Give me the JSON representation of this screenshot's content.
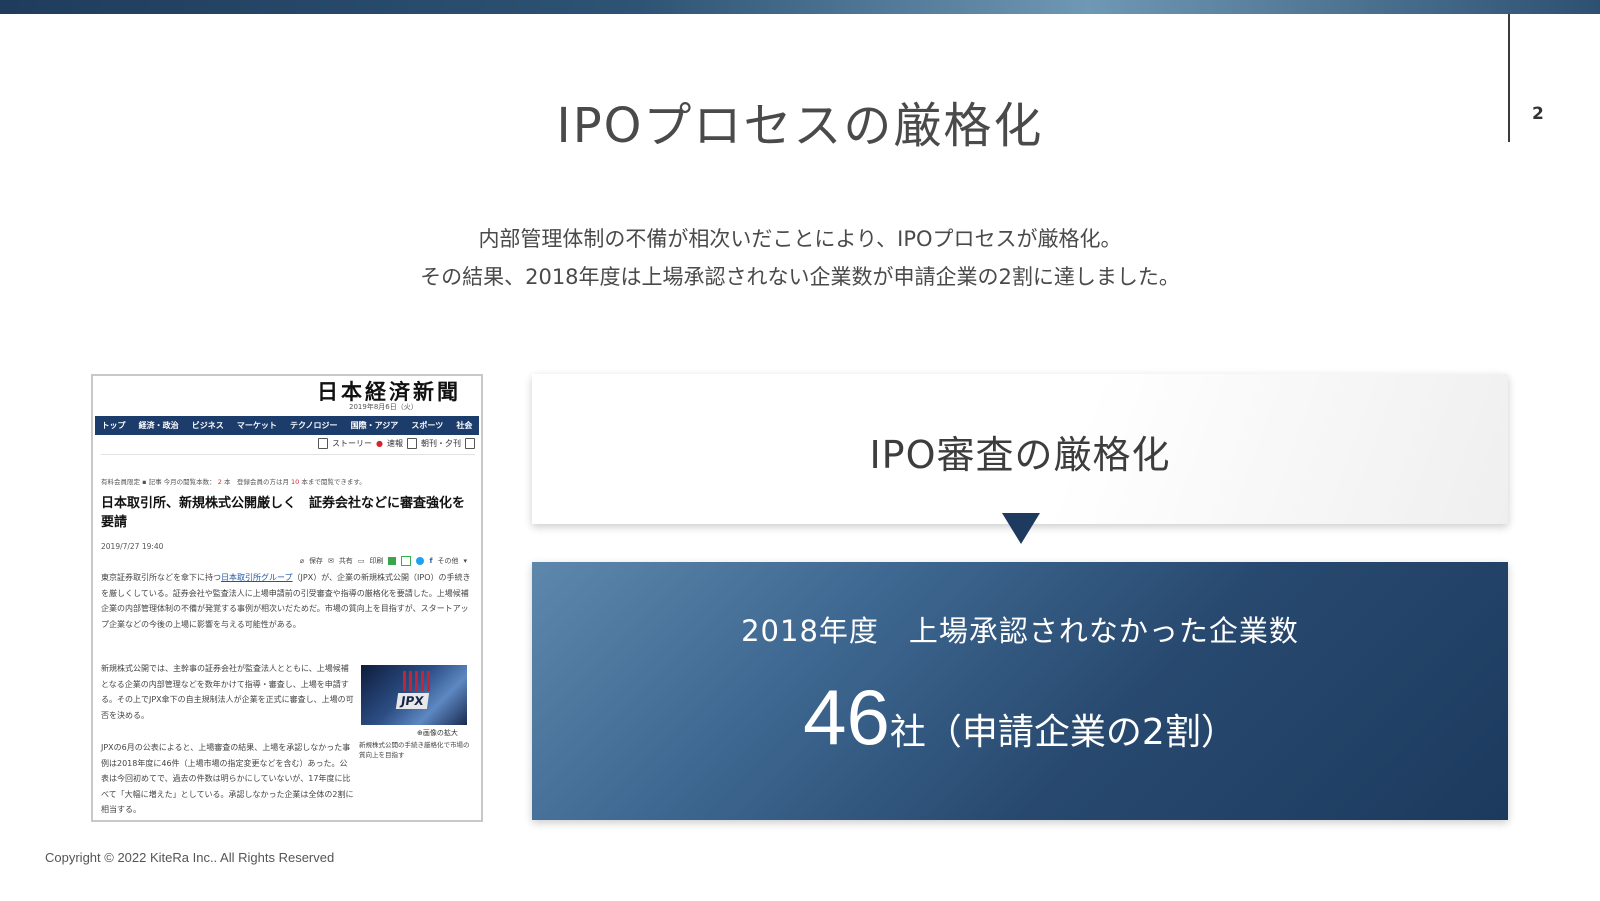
{
  "header": {
    "page_number": "2"
  },
  "slide": {
    "title": "IPOプロセスの厳格化",
    "lead_line1": "内部管理体制の不備が相次いだことにより、IPOプロセスが厳格化。",
    "lead_line2": "その結果、2018年度は上場承認されない企業数が申請企業の2割に達しました。"
  },
  "newspaper": {
    "masthead": "日本経済新聞",
    "date": "2019年8月6日（火）",
    "nav": [
      "トップ",
      "経済・政治",
      "ビジネス",
      "マーケット",
      "テクノロジー",
      "国際・アジア",
      "スポーツ",
      "社会"
    ],
    "tools": {
      "story": "ストーリー",
      "news": "速報",
      "edition": "朝刊・夕刊"
    },
    "member_prefix": "有料会員限定",
    "member_article": "記事 今月の閲覧本数：",
    "member_count": "2",
    "member_mid": "本　登録会員の方は月",
    "member_limit": "10",
    "member_suffix": "本まで閲覧できます。",
    "headline": "日本取引所、新規株式公開厳しく　証券会社などに審査強化を要請",
    "timestamp": "2019/7/27 19:40",
    "share": {
      "save": "保存",
      "share": "共有",
      "print": "印刷",
      "other": "その他"
    },
    "p1_before": "東京証券取引所などを傘下に持つ",
    "p1_link": "日本取引所グループ",
    "p1_after": "（JPX）が、企業の新規株式公開（IPO）の手続きを厳しくしている。証券会社や監査法人に上場申請前の引受審査や指導の厳格化を要請した。上場候補企業の内部管理体制の不備が発覚する事例が相次いだためだ。市場の質向上を目指すが、スタートアップ企業などの今後の上場に影響を与える可能性がある。",
    "p2": "新規株式公開では、主幹事の証券会社が監査法人とともに、上場候補となる企業の内部管理などを数年かけて指導・審査し、上場を申請する。その上でJPX傘下の自主規制法人が企業を正式に審査し、上場の可否を決める。",
    "p3": "JPXの6月の公表によると、上場審査の結果、上場を承認しなかった事例は2018年度に46件（上場市場の指定変更などを含む）あった。公表は今回初めてで、過去の件数は明らかにしていないが、17年度に比べて「大幅に増えた」としている。承認しなかった企業は全体の2割に相当する。",
    "photo_logo": "JPX",
    "photo_zoom": "画像の拡大",
    "photo_caption": "新規株式公開の手続き厳格化で市場の質向上を目指す"
  },
  "review_card": {
    "title": "IPO審査の厳格化"
  },
  "result_card": {
    "label": "2018年度　上場承認されなかった企業数",
    "number": "46",
    "unit": "社（申請企業の2割）"
  },
  "footer": {
    "copyright": "Copyright © 2022 KiteRa Inc.. All Rights Reserved"
  },
  "colors": {
    "navy": "#1e3a5e",
    "accent_light": "#6f98b4"
  }
}
